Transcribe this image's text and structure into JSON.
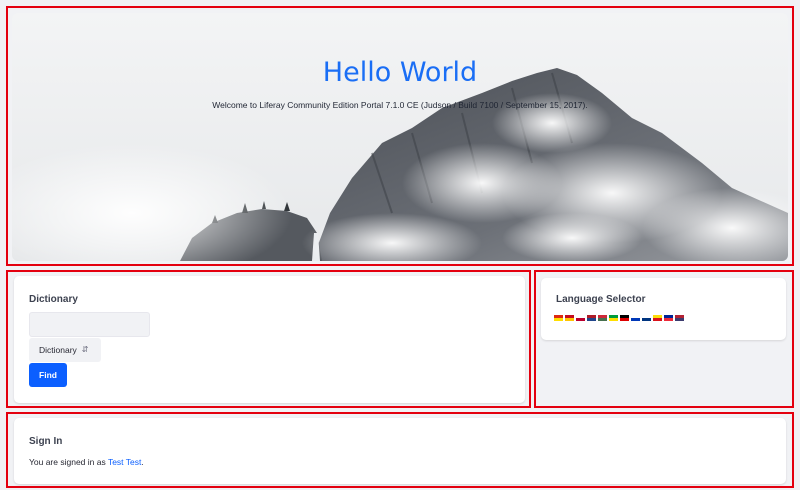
{
  "hero": {
    "title": "Hello World",
    "subtitle": "Welcome to Liferay Community Edition Portal 7.1.0 CE (Judson / Build 7100 / September 15, 2017)."
  },
  "dictionary": {
    "title": "Dictionary",
    "input_value": "",
    "select_value": "Dictionary",
    "find_label": "Find"
  },
  "language_selector": {
    "title": "Language Selector",
    "flags": [
      {
        "name": "chinese-flag-icon",
        "colors": [
          "#de2910",
          "#ffde00"
        ]
      },
      {
        "name": "spanish-flag-icon",
        "colors": [
          "#c60b1e",
          "#ffc400"
        ]
      },
      {
        "name": "japanese-flag-icon",
        "colors": [
          "#ffffff",
          "#bc002d"
        ]
      },
      {
        "name": "dutch-flag-icon",
        "colors": [
          "#ae1c28",
          "#21468b"
        ]
      },
      {
        "name": "hungarian-flag-icon",
        "colors": [
          "#ce2939",
          "#477050"
        ]
      },
      {
        "name": "brazilian-flag-icon",
        "colors": [
          "#009c3b",
          "#ffdf00"
        ]
      },
      {
        "name": "german-flag-icon",
        "colors": [
          "#000000",
          "#dd0000"
        ]
      },
      {
        "name": "hebrew-flag-icon",
        "colors": [
          "#ffffff",
          "#0038b8"
        ]
      },
      {
        "name": "finnish-flag-icon",
        "colors": [
          "#ffffff",
          "#003580"
        ]
      },
      {
        "name": "catalan-flag-icon",
        "colors": [
          "#fcdd09",
          "#da121a"
        ]
      },
      {
        "name": "french-flag-icon",
        "colors": [
          "#002395",
          "#ed2939"
        ]
      },
      {
        "name": "us-flag-icon",
        "colors": [
          "#b22234",
          "#3c3b6e"
        ]
      }
    ]
  },
  "sign_in": {
    "title": "Sign In",
    "text_prefix": "You are signed in as ",
    "user_name": "Test Test",
    "text_suffix": "."
  },
  "colors": {
    "primary": "#0b5fff",
    "hero_title": "#1a6ef5",
    "highlight_border": "#e4000f"
  }
}
